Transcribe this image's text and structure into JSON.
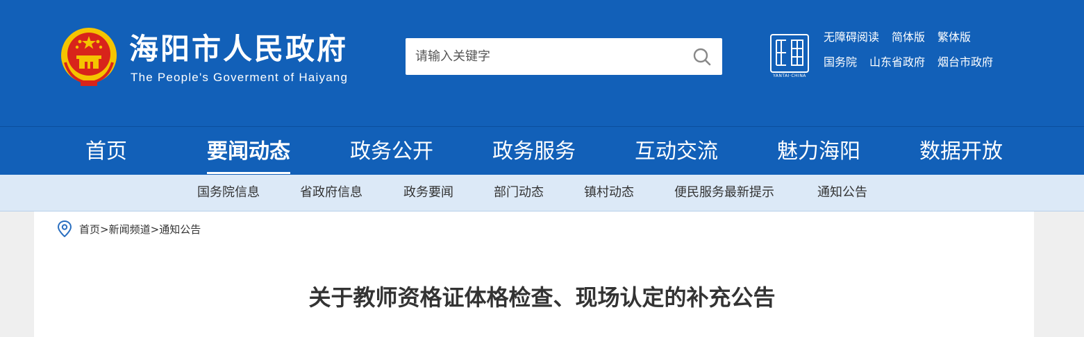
{
  "header": {
    "title": "海阳市人民政府",
    "subtitle": "The People's Goverment of Haiyang",
    "search": {
      "placeholder": "请输入关键字"
    },
    "seal_text": "YANTAI·CHINA",
    "toplinks_row1": [
      "无障碍阅读",
      "简体版",
      "繁体版"
    ],
    "toplinks_row2": [
      "国务院",
      "山东省政府",
      "烟台市政府"
    ]
  },
  "nav": {
    "items": [
      "首页",
      "要闻动态",
      "政务公开",
      "政务服务",
      "互动交流",
      "魅力海阳",
      "数据开放"
    ],
    "active": "要闻动态"
  },
  "subnav": {
    "items": [
      "国务院信息",
      "省政府信息",
      "政务要闻",
      "部门动态",
      "镇村动态",
      "便民服务最新提示",
      "通知公告"
    ]
  },
  "breadcrumb": {
    "items": [
      "首页",
      "新闻频道",
      "通知公告"
    ],
    "separator": ">"
  },
  "article": {
    "title": "关于教师资格证体格检查、现场认定的补充公告"
  },
  "colors": {
    "brand_blue": "#1260b8",
    "subnav_bg": "#dce9f7",
    "emblem_red": "#d8241b",
    "emblem_gold": "#f5c400"
  },
  "icons": {
    "search": "search-icon",
    "location": "location-pin-icon"
  }
}
